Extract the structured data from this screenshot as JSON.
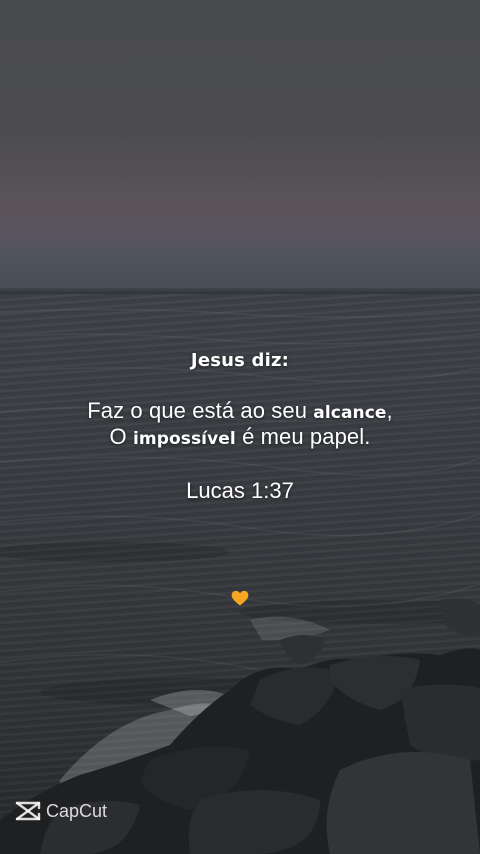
{
  "quote": {
    "title": "Jesus diz:",
    "line1_pre": "Faz o que está ao seu ",
    "line1_emph": "alcance",
    "line1_post": ",",
    "line2_pre": "O ",
    "line2_emph": "impossível",
    "line2_post": " é meu papel.",
    "reference": "Lucas 1:37"
  },
  "decoration": {
    "heart_icon": "orange-heart-icon",
    "heart_color": "#f5a623"
  },
  "watermark": {
    "icon": "capcut-logo-icon",
    "text": "CapCut"
  }
}
